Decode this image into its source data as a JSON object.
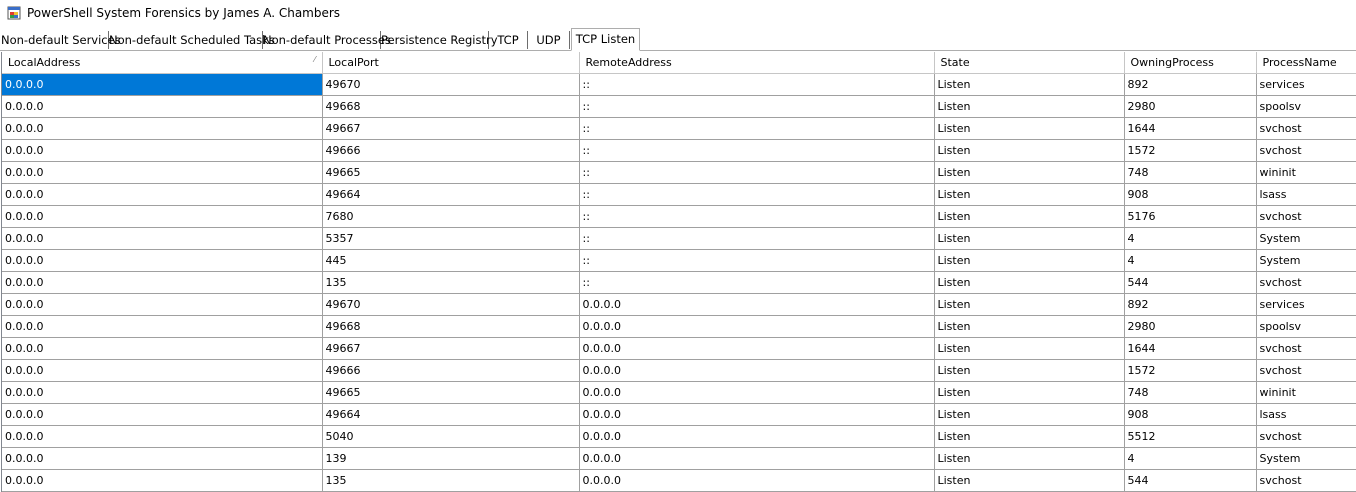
{
  "window": {
    "title": "PowerShell System Forensics by James A. Chambers",
    "icon": "app-window-icon"
  },
  "tabs": [
    {
      "label": "Non-default Services",
      "active": false
    },
    {
      "label": "Non-default Scheduled Tasks",
      "active": false
    },
    {
      "label": "Non-default Processes",
      "active": false
    },
    {
      "label": "Persistence Registry",
      "active": false
    },
    {
      "label": "TCP",
      "active": false
    },
    {
      "label": "UDP",
      "active": false
    },
    {
      "label": "TCP Listen",
      "active": true
    }
  ],
  "grid": {
    "columns": [
      "LocalAddress",
      "LocalPort",
      "RemoteAddress",
      "State",
      "OwningProcess",
      "ProcessName"
    ],
    "sort_column": "LocalAddress",
    "selected_row": 0,
    "rows": [
      [
        "0.0.0.0",
        "49670",
        "::",
        "Listen",
        "892",
        "services"
      ],
      [
        "0.0.0.0",
        "49668",
        "::",
        "Listen",
        "2980",
        "spoolsv"
      ],
      [
        "0.0.0.0",
        "49667",
        "::",
        "Listen",
        "1644",
        "svchost"
      ],
      [
        "0.0.0.0",
        "49666",
        "::",
        "Listen",
        "1572",
        "svchost"
      ],
      [
        "0.0.0.0",
        "49665",
        "::",
        "Listen",
        "748",
        "wininit"
      ],
      [
        "0.0.0.0",
        "49664",
        "::",
        "Listen",
        "908",
        "lsass"
      ],
      [
        "0.0.0.0",
        "7680",
        "::",
        "Listen",
        "5176",
        "svchost"
      ],
      [
        "0.0.0.0",
        "5357",
        "::",
        "Listen",
        "4",
        "System"
      ],
      [
        "0.0.0.0",
        "445",
        "::",
        "Listen",
        "4",
        "System"
      ],
      [
        "0.0.0.0",
        "135",
        "::",
        "Listen",
        "544",
        "svchost"
      ],
      [
        "0.0.0.0",
        "49670",
        "0.0.0.0",
        "Listen",
        "892",
        "services"
      ],
      [
        "0.0.0.0",
        "49668",
        "0.0.0.0",
        "Listen",
        "2980",
        "spoolsv"
      ],
      [
        "0.0.0.0",
        "49667",
        "0.0.0.0",
        "Listen",
        "1644",
        "svchost"
      ],
      [
        "0.0.0.0",
        "49666",
        "0.0.0.0",
        "Listen",
        "1572",
        "svchost"
      ],
      [
        "0.0.0.0",
        "49665",
        "0.0.0.0",
        "Listen",
        "748",
        "wininit"
      ],
      [
        "0.0.0.0",
        "49664",
        "0.0.0.0",
        "Listen",
        "908",
        "lsass"
      ],
      [
        "0.0.0.0",
        "5040",
        "0.0.0.0",
        "Listen",
        "5512",
        "svchost"
      ],
      [
        "0.0.0.0",
        "139",
        "0.0.0.0",
        "Listen",
        "4",
        "System"
      ],
      [
        "0.0.0.0",
        "135",
        "0.0.0.0",
        "Listen",
        "544",
        "svchost"
      ]
    ]
  },
  "colors": {
    "selection": "#0078d7",
    "grid_line": "#a0a0a0"
  }
}
